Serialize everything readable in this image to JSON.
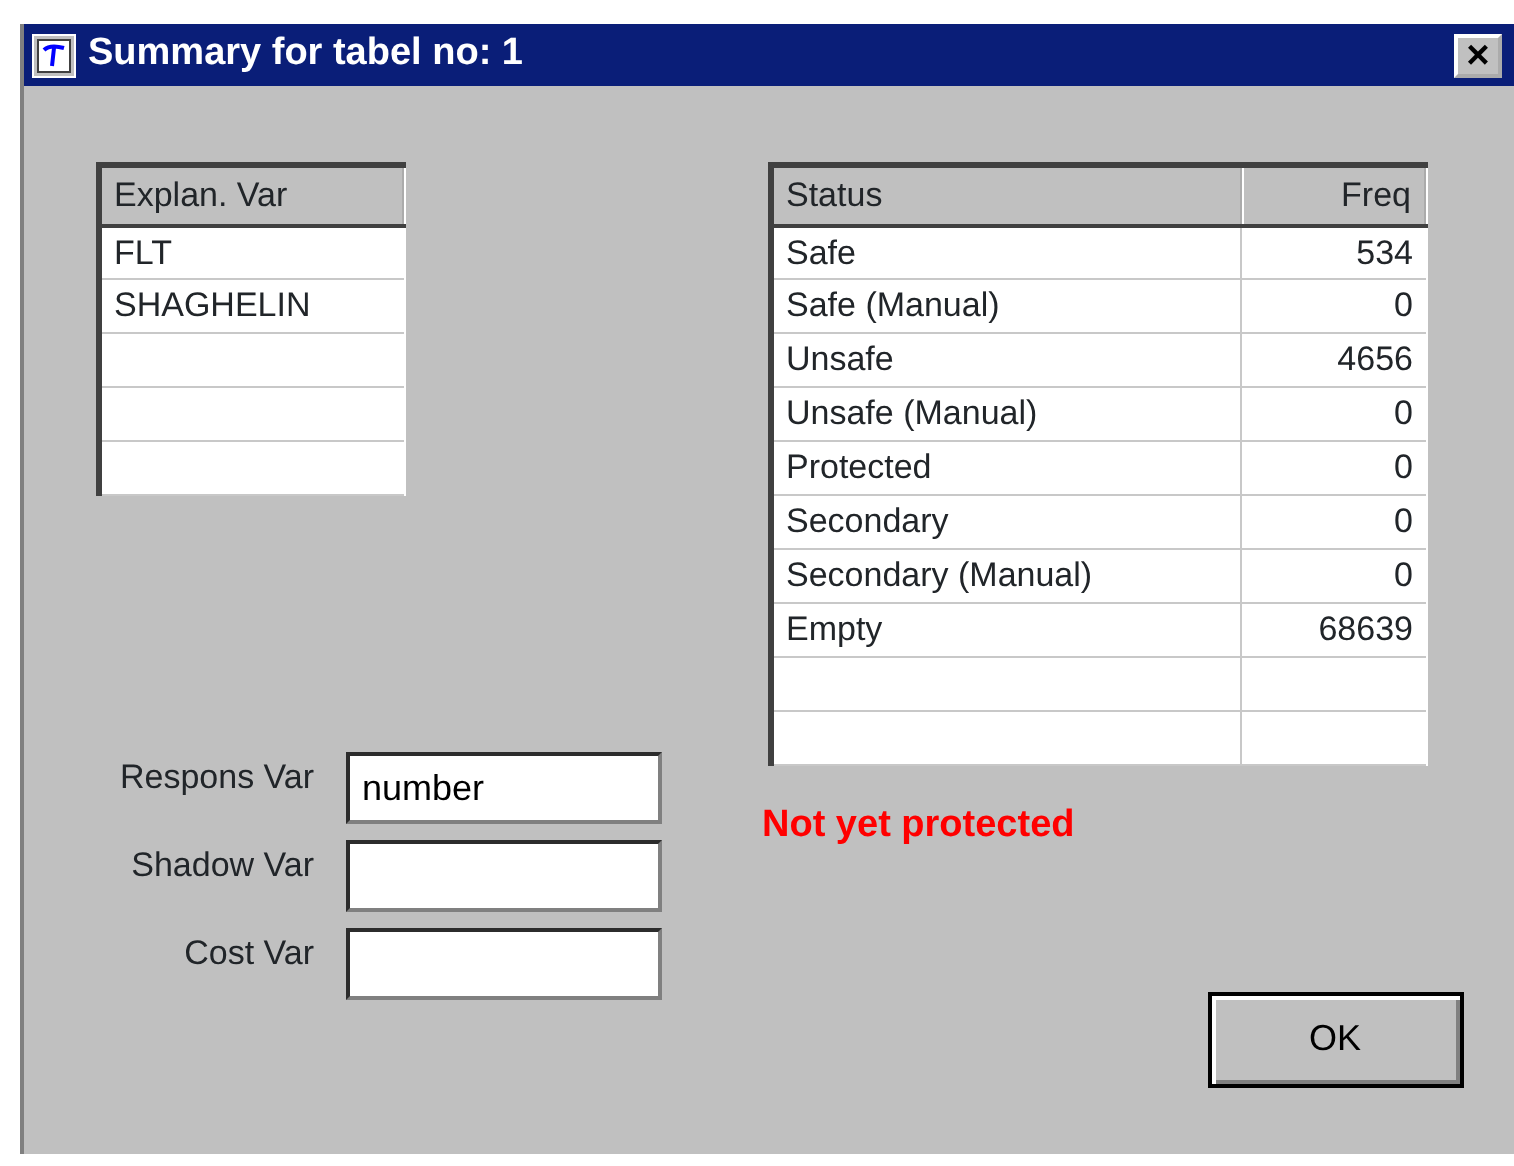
{
  "window": {
    "title": "Summary for tabel no: 1",
    "close": "×"
  },
  "explan_table": {
    "columns": [
      "Explan. Var"
    ],
    "rows": [
      "FLT",
      "SHAGHELIN"
    ]
  },
  "status_table": {
    "columns": [
      "Status",
      "Freq"
    ],
    "rows": [
      {
        "status": "Safe",
        "freq": "534"
      },
      {
        "status": "Safe (Manual)",
        "freq": "0"
      },
      {
        "status": "Unsafe",
        "freq": "4656"
      },
      {
        "status": "Unsafe (Manual)",
        "freq": "0"
      },
      {
        "status": "Protected",
        "freq": "0"
      },
      {
        "status": "Secondary",
        "freq": "0"
      },
      {
        "status": "Secondary (Manual)",
        "freq": "0"
      },
      {
        "status": "Empty",
        "freq": "68639"
      }
    ]
  },
  "fields": [
    {
      "label": "Respons Var",
      "value": "number"
    },
    {
      "label": "Shadow Var"
    },
    {
      "label": "Cost Var"
    }
  ],
  "status_message": "Not yet protected",
  "buttons": [
    "OK"
  ]
}
